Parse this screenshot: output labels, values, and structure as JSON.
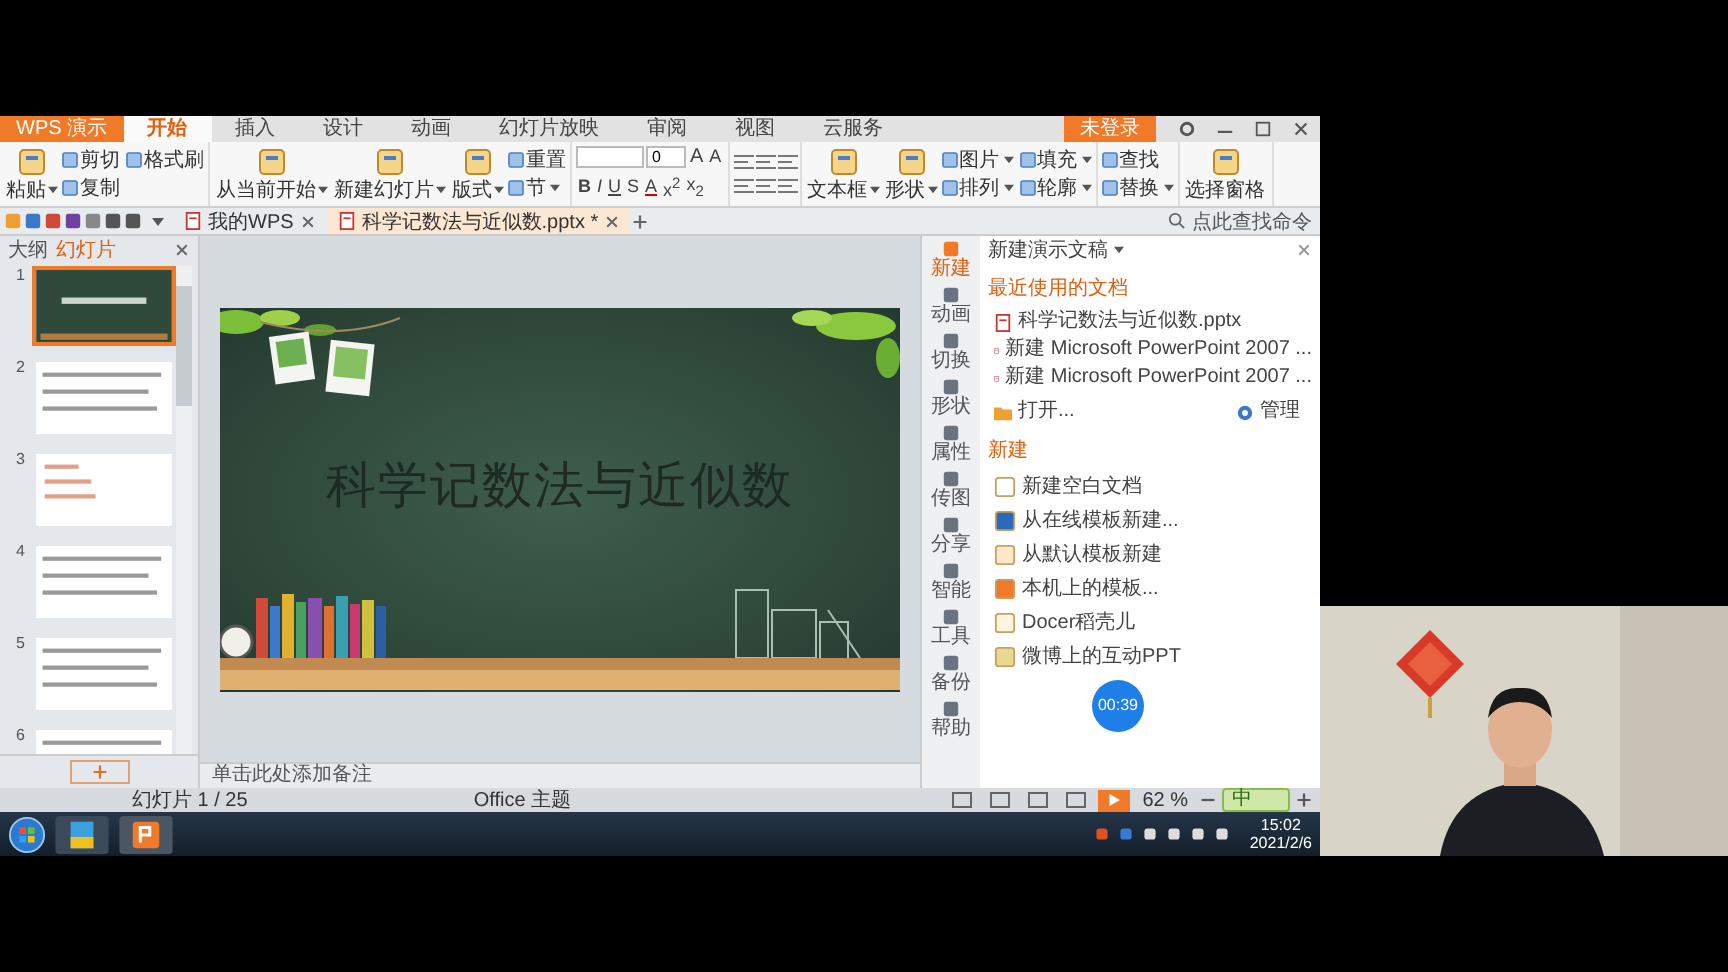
{
  "menu": {
    "app_button": "WPS 演示",
    "tabs": [
      {
        "label": "开始",
        "selected": true
      },
      {
        "label": "插入",
        "selected": false
      },
      {
        "label": "设计",
        "selected": false
      },
      {
        "label": "动画",
        "selected": false
      },
      {
        "label": "幻灯片放映",
        "selected": false
      },
      {
        "label": "审阅",
        "selected": false
      },
      {
        "label": "视图",
        "selected": false
      },
      {
        "label": "云服务",
        "selected": false
      }
    ],
    "login_button": "未登录"
  },
  "ribbon": {
    "groups": [
      {
        "kind": "tools",
        "large": [
          {
            "label": "粘贴",
            "dropdown": true
          }
        ],
        "small": [
          {
            "label": "剪切",
            "dropdown": false
          },
          {
            "label": "复制",
            "dropdown": false
          },
          {
            "label": "格式刷",
            "dropdown": false
          }
        ]
      },
      {
        "kind": "tools",
        "large": [
          {
            "label": "从当前开始",
            "dropdown": true
          },
          {
            "label": "新建幻灯片",
            "dropdown": true
          },
          {
            "label": "版式",
            "dropdown": true
          }
        ],
        "small": [
          {
            "label": "重置",
            "dropdown": false
          },
          {
            "label": "节",
            "dropdown": true
          }
        ]
      },
      {
        "kind": "font",
        "font_size": "0",
        "size_buttons": [
          "A",
          "A"
        ],
        "styles": [
          "B",
          "I",
          "U",
          "S",
          "A",
          "x$^{2}$",
          "x$_{2}$"
        ]
      },
      {
        "kind": "paragraph"
      },
      {
        "kind": "tools",
        "large": [
          {
            "label": "文本框",
            "dropdown": true
          },
          {
            "label": "形状",
            "dropdown": true
          }
        ],
        "small": [
          {
            "label": "图片",
            "dropdown": true
          },
          {
            "label": "排列",
            "dropdown": true
          },
          {
            "label": "填充",
            "dropdown": true
          },
          {
            "label": "轮廓",
            "dropdown": true
          }
        ]
      },
      {
        "kind": "tools",
        "small": [
          {
            "label": "查找",
            "dropdown": false
          },
          {
            "label": "替换",
            "dropdown": true
          }
        ]
      },
      {
        "kind": "tools",
        "large": [
          {
            "label": "选择窗格",
            "dropdown": false
          }
        ]
      }
    ]
  },
  "doc_tabs": [
    {
      "label": "我的WPS",
      "selected": false
    },
    {
      "label": "科学记数法与近似数.pptx *",
      "selected": true
    }
  ],
  "command_search": "点此查找命令",
  "left_panel": {
    "tabs": [
      {
        "label": "大纲",
        "selected": false
      },
      {
        "label": "幻灯片",
        "selected": true
      }
    ],
    "slides": [
      {
        "number": "1",
        "kind": "title",
        "selected": true
      },
      {
        "number": "2",
        "kind": "text",
        "selected": false
      },
      {
        "number": "3",
        "kind": "formula",
        "selected": false
      },
      {
        "number": "4",
        "kind": "text",
        "selected": false
      },
      {
        "number": "5",
        "kind": "text",
        "selected": false
      },
      {
        "number": "6",
        "kind": "text",
        "selected": false
      }
    ]
  },
  "slide": {
    "title": "科学记数法与近似数"
  },
  "notes_placeholder": "单击此处添加备注",
  "side_tools": [
    {
      "label": "新建",
      "selected": true
    },
    {
      "label": "动画",
      "selected": false
    },
    {
      "label": "切换",
      "selected": false
    },
    {
      "label": "形状",
      "selected": false
    },
    {
      "label": "属性",
      "selected": false
    },
    {
      "label": "传图",
      "selected": false
    },
    {
      "label": "分享",
      "selected": false
    },
    {
      "label": "智能",
      "selected": false
    },
    {
      "label": "工具",
      "selected": false
    },
    {
      "label": "备份",
      "selected": false
    },
    {
      "label": "帮助",
      "selected": false
    }
  ],
  "task_pane": {
    "title": "新建演示文稿",
    "recent_heading": "最近使用的文档",
    "recent": [
      "科学记数法与近似数.pptx",
      "新建 Microsoft PowerPoint 2007 ...",
      "新建 Microsoft PowerPoint 2007 ..."
    ],
    "open": "打开...",
    "manage": "管理",
    "new_heading": "新建",
    "new_items": [
      "新建空白文档",
      "从在线模板新建...",
      "从默认模板新建",
      "本机上的模板...",
      "Docer稻壳儿",
      "微博上的互动PPT"
    ]
  },
  "timer": "00:39",
  "status_bar": {
    "slide_count": "幻灯片 1 / 25",
    "theme": "Office 主题",
    "zoom": "62 %",
    "ime": "中"
  },
  "taskbar": {
    "time": "15:02",
    "date": "2021/2/6"
  }
}
